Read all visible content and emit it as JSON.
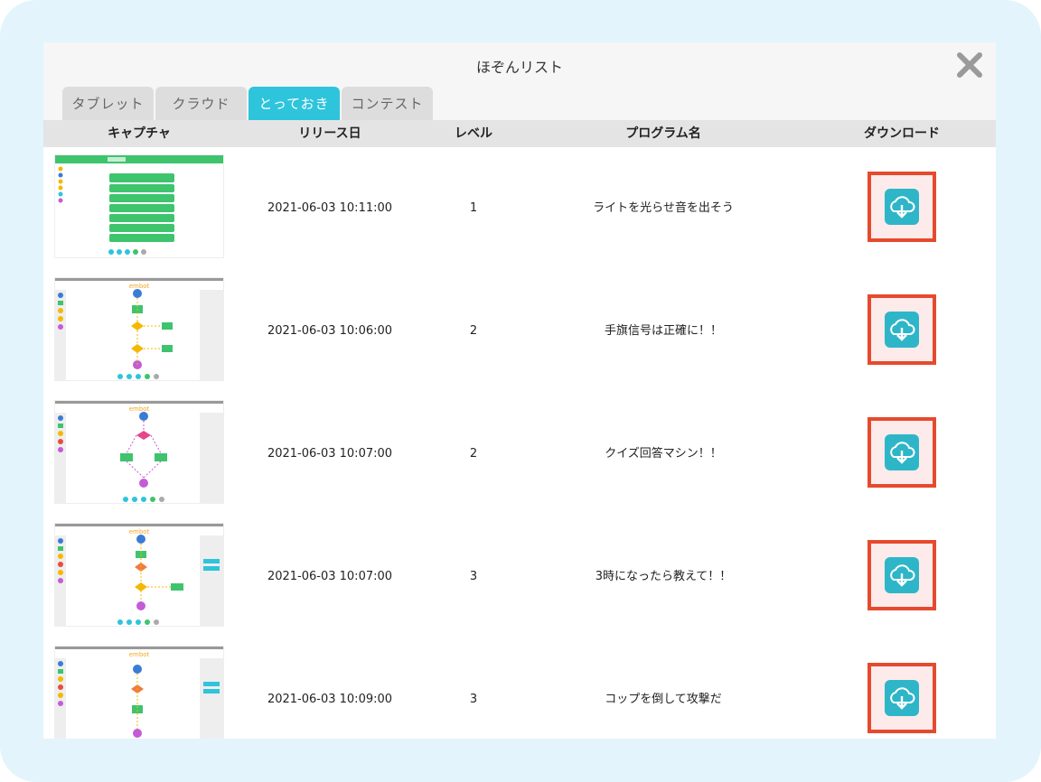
{
  "dialog": {
    "title": "ほぞんリスト",
    "close_icon": "close-icon"
  },
  "tabs": [
    {
      "label": "タブレット",
      "active": false
    },
    {
      "label": "クラウド",
      "active": false
    },
    {
      "label": "とっておき",
      "active": true
    },
    {
      "label": "コンテスト",
      "active": false
    }
  ],
  "columns": {
    "capture": "キャプチャ",
    "release_date": "リリース日",
    "level": "レベル",
    "program_name": "プログラム名",
    "download": "ダウンロード"
  },
  "rows": [
    {
      "date": "2021-06-03 10:11:00",
      "level": "1",
      "name": "ライトを光らせ音を出そう",
      "thumb": "green-blocks",
      "download_icon": "cloud-download-icon"
    },
    {
      "date": "2021-06-03 10:06:00",
      "level": "2",
      "name": "手旗信号は正確に！！",
      "thumb": "flow-branch",
      "download_icon": "cloud-download-icon"
    },
    {
      "date": "2021-06-03 10:07:00",
      "level": "2",
      "name": "クイズ回答マシン！！",
      "thumb": "flow-diamond",
      "download_icon": "cloud-download-icon"
    },
    {
      "date": "2021-06-03 10:07:00",
      "level": "3",
      "name": "3時になったら教えて！！",
      "thumb": "flow-condition",
      "download_icon": "cloud-download-icon"
    },
    {
      "date": "2021-06-03 10:09:00",
      "level": "3",
      "name": "コップを倒して攻撃だ",
      "thumb": "flow-attack",
      "download_icon": "cloud-download-icon"
    }
  ],
  "thumb_labels": {
    "brand": "embot"
  },
  "colors": {
    "accent": "#2ec4dc",
    "highlight": "#e64a2e",
    "background": "#e3f4fc"
  }
}
